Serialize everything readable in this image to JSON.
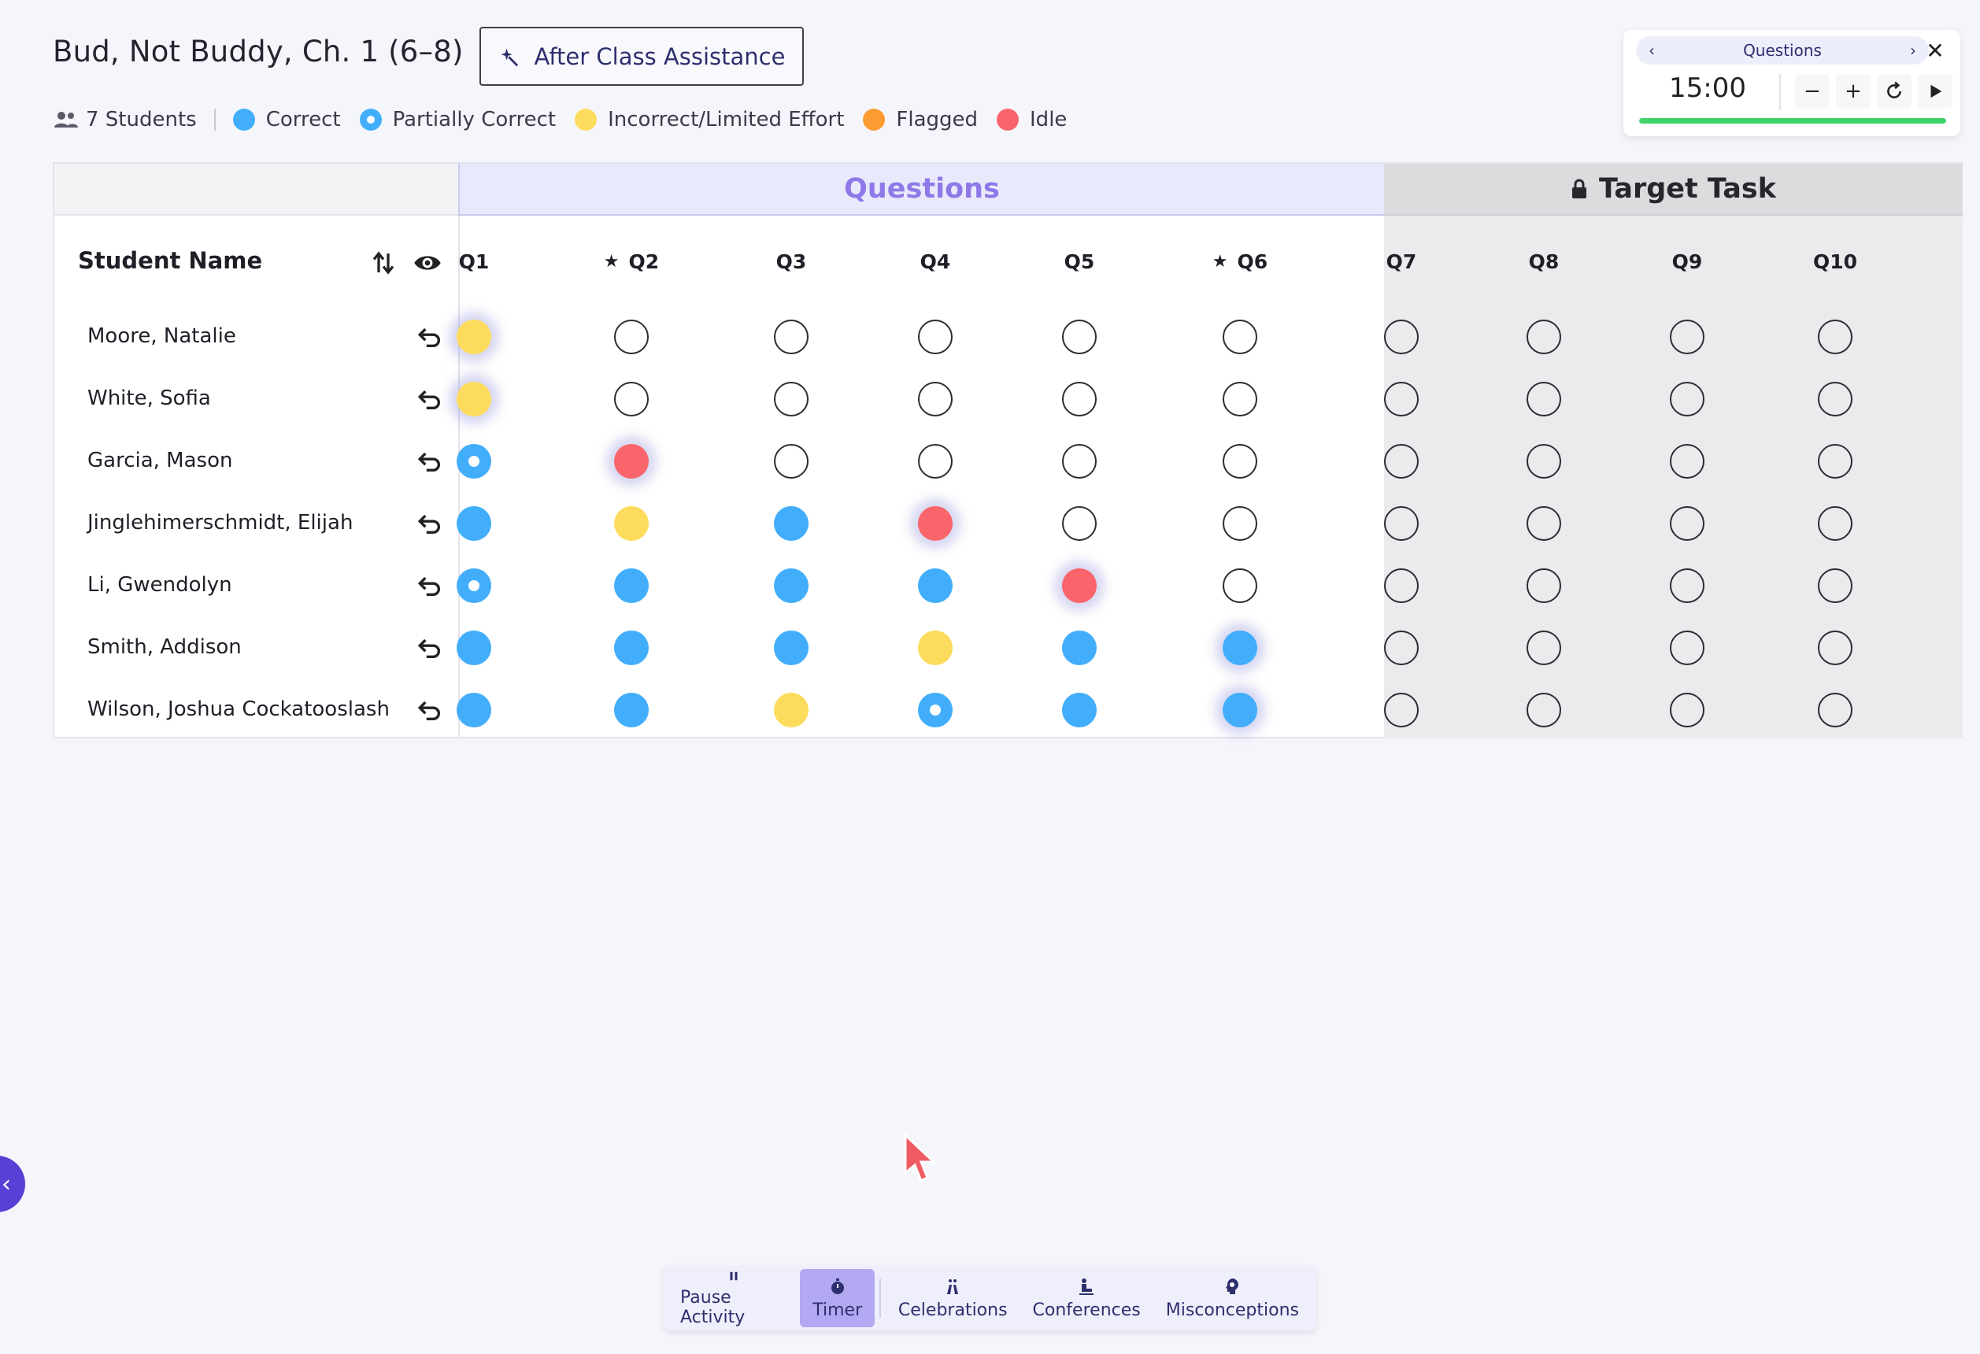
{
  "header": {
    "title": "Bud, Not Buddy, Ch. 1 (6–8)",
    "assist_label": "After Class Assistance"
  },
  "legend": {
    "students": "7 Students",
    "items": [
      {
        "key": "correct",
        "label": "Correct"
      },
      {
        "key": "partial",
        "label": "Partially Correct"
      },
      {
        "key": "incorrect",
        "label": "Incorrect/Limited Effort"
      },
      {
        "key": "flagged",
        "label": "Flagged"
      },
      {
        "key": "idle",
        "label": "Idle"
      }
    ]
  },
  "timer": {
    "label": "Questions",
    "time": "15:00",
    "progress": 1.0
  },
  "table": {
    "questions_band": "Questions",
    "target_band": "Target Task",
    "name_header": "Student Name",
    "columns": [
      "Q1",
      "Q2",
      "Q3",
      "Q4",
      "Q5",
      "Q6",
      "Q7",
      "Q8",
      "Q9",
      "Q10"
    ],
    "starred": [
      "Q2",
      "Q6"
    ],
    "rows": [
      {
        "name": "Moore, Natalie",
        "cells": [
          "incorrect*",
          "empty",
          "empty",
          "empty",
          "empty",
          "empty",
          "empty",
          "empty",
          "empty",
          "empty"
        ]
      },
      {
        "name": "White, Sofia",
        "cells": [
          "incorrect*",
          "empty",
          "empty",
          "empty",
          "empty",
          "empty",
          "empty",
          "empty",
          "empty",
          "empty"
        ]
      },
      {
        "name": "Garcia, Mason",
        "cells": [
          "partial",
          "idle*",
          "empty",
          "empty",
          "empty",
          "empty",
          "empty",
          "empty",
          "empty",
          "empty"
        ]
      },
      {
        "name": "Jinglehimerschmidt, Elijah",
        "cells": [
          "correct",
          "incorrect",
          "correct",
          "idle*",
          "empty",
          "empty",
          "empty",
          "empty",
          "empty",
          "empty"
        ]
      },
      {
        "name": "Li, Gwendolyn",
        "cells": [
          "partial",
          "correct",
          "correct",
          "correct",
          "idle*",
          "empty",
          "empty",
          "empty",
          "empty",
          "empty"
        ]
      },
      {
        "name": "Smith, Addison",
        "cells": [
          "correct",
          "correct",
          "correct",
          "incorrect",
          "correct",
          "correct*",
          "empty",
          "empty",
          "empty",
          "empty"
        ]
      },
      {
        "name": "Wilson, Joshua Cockatooslash",
        "cells": [
          "correct",
          "correct",
          "incorrect",
          "partial",
          "correct",
          "correct*",
          "empty",
          "empty",
          "empty",
          "empty"
        ]
      }
    ]
  },
  "toolbar": {
    "items": [
      {
        "key": "pause",
        "label": "Pause Activity"
      },
      {
        "key": "timer",
        "label": "Timer",
        "active": true
      },
      {
        "key": "celebrations",
        "label": "Celebrations"
      },
      {
        "key": "conferences",
        "label": "Conferences"
      },
      {
        "key": "misconceptions",
        "label": "Misconceptions"
      }
    ]
  },
  "colors": {
    "correct": "#42aefb",
    "incorrect": "#fddc5d",
    "flagged": "#fb9b32",
    "idle": "#f9656b",
    "accent": "#8f78e8"
  }
}
